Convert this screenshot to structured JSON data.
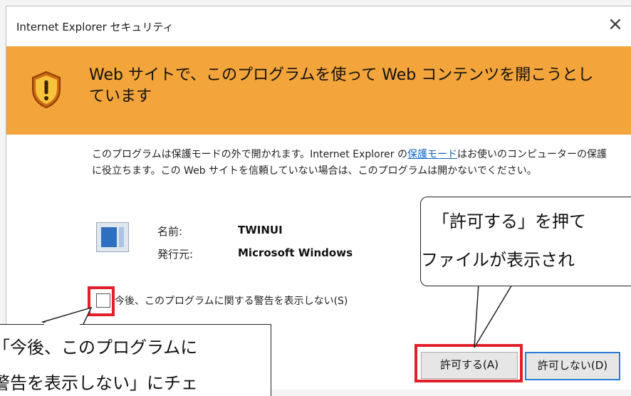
{
  "window": {
    "title": "Internet Explorer セキュリティ",
    "close": "×"
  },
  "banner": {
    "text": "Web サイトで、このプログラムを使って Web コンテンツを開こうとしています"
  },
  "description": {
    "before_link": "このプログラムは保護モードの外で開かれます。Internet Explorer の",
    "link": "保護モード",
    "after_link": "はお使いのコンピューターの保護に役立ちます。この Web サイトを信頼していない場合は、このプログラムは開かないでください。"
  },
  "program": {
    "name_label": "名前:",
    "name_value": "TWINUI",
    "publisher_label": "発行元:",
    "publisher_value": "Microsoft Windows"
  },
  "checkbox": {
    "label": "今後、このプログラムに関する警告を表示しない(S)",
    "checked": false
  },
  "buttons": {
    "allow": "許可する(A)",
    "deny": "許可しない(D)"
  },
  "annotations": {
    "right_line1": "「許可する」を押て",
    "right_line2": "ファイルが表示され",
    "left_line1": "「今後、このプログラムに",
    "left_line2": "警告を表示しない」にチェ"
  },
  "colors": {
    "banner": "#f3a43a",
    "highlight": "#e0202a",
    "link": "#1565c0"
  }
}
